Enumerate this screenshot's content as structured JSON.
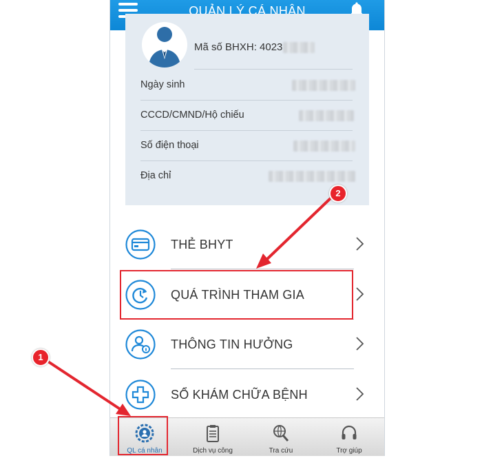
{
  "header": {
    "title": "QUẢN LÝ CÁ NHÂN"
  },
  "profile": {
    "bhxh_label": "Mã số BHXH: 4023",
    "rows": [
      {
        "label": "Ngày sinh"
      },
      {
        "label": "CCCD/CMND/Hộ chiếu"
      },
      {
        "label": "Số điện thoại"
      },
      {
        "label": "Địa chỉ"
      }
    ]
  },
  "menu": [
    {
      "label": "THẺ BHYT",
      "icon": "health-card-icon"
    },
    {
      "label": "QUÁ TRÌNH THAM GIA",
      "icon": "refresh-clock-icon"
    },
    {
      "label": "THÔNG TIN HƯỞNG",
      "icon": "user-info-icon"
    },
    {
      "label": "SỔ KHÁM CHỮA BỆNH",
      "icon": "medical-cross-icon"
    }
  ],
  "tabs": [
    {
      "label": "QL cá nhân",
      "icon": "gear-user-icon"
    },
    {
      "label": "Dịch vụ công",
      "icon": "clipboard-icon"
    },
    {
      "label": "Tra cứu",
      "icon": "globe-search-icon"
    },
    {
      "label": "Trợ giúp",
      "icon": "headset-icon"
    }
  ],
  "annotations": {
    "badge1": "1",
    "badge2": "2"
  },
  "colors": {
    "header": "#1591dd",
    "accent_icon": "#1e88d8",
    "annotation": "#e3262f"
  }
}
